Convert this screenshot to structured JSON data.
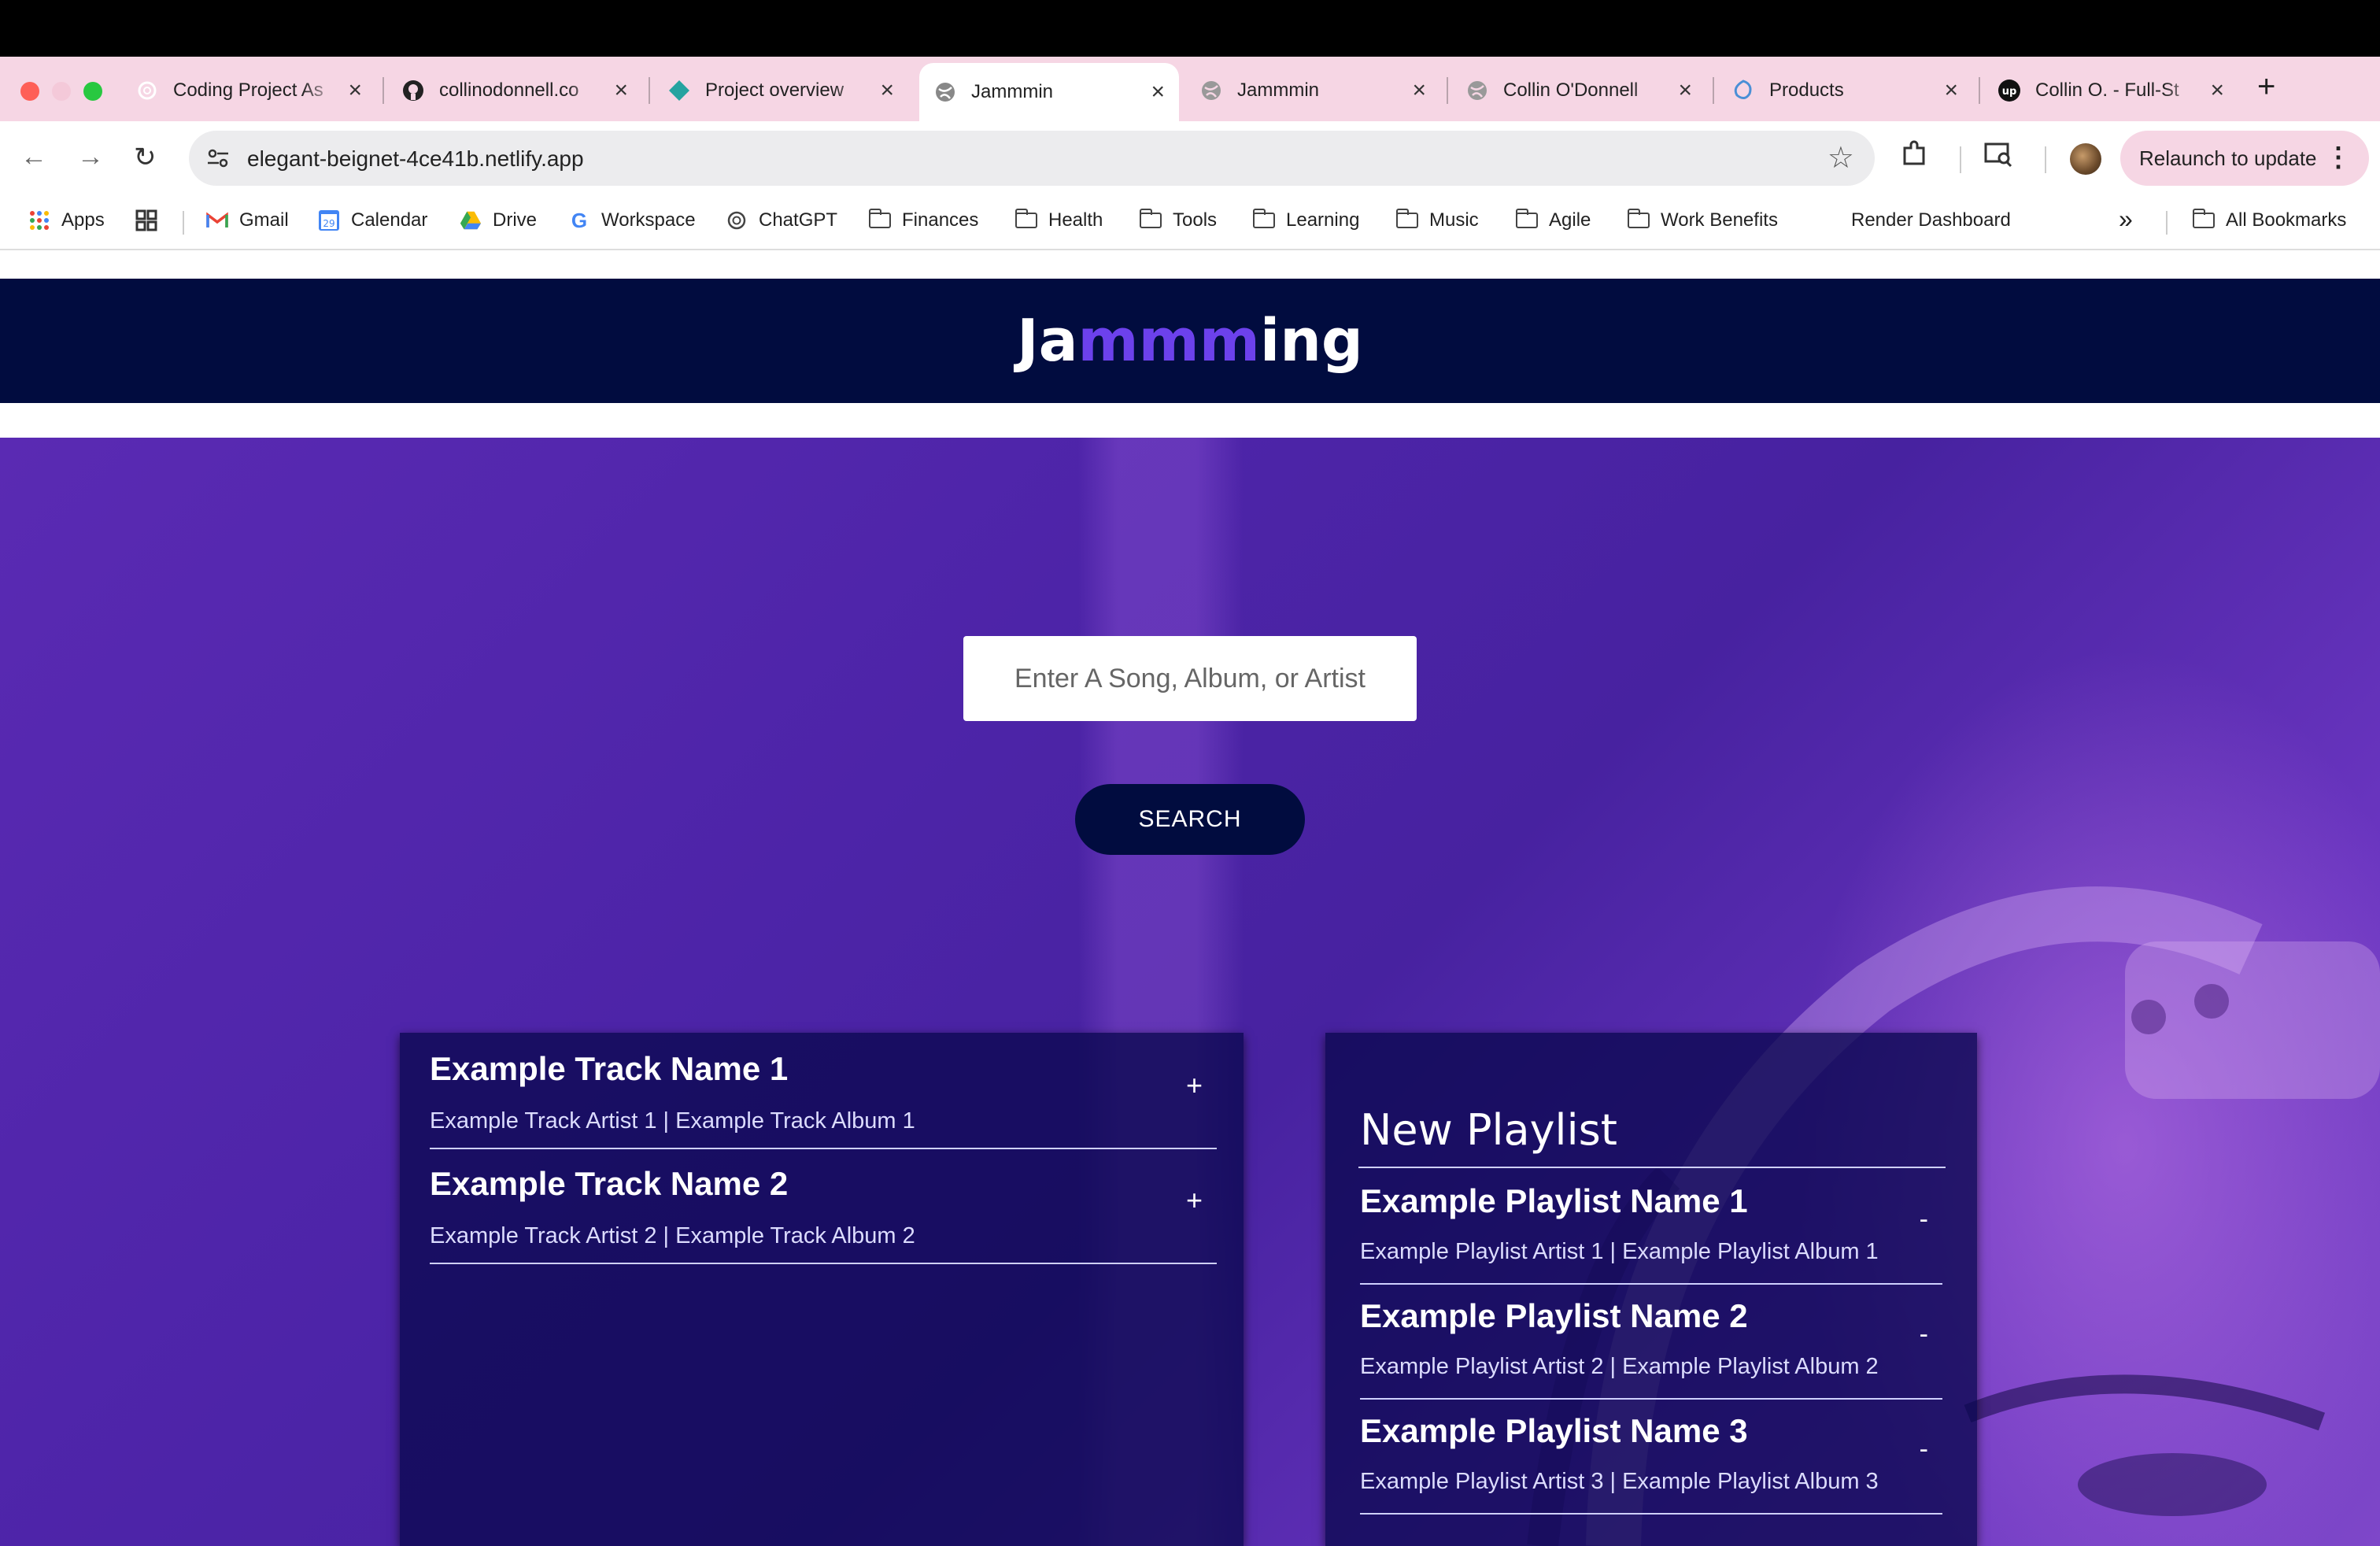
{
  "browser": {
    "tabs": [
      {
        "title": "Coding Project As",
        "icon": "openai-icon"
      },
      {
        "title": "collinodonnell.co",
        "icon": "github-icon"
      },
      {
        "title": "Project overview",
        "icon": "netlify-icon"
      },
      {
        "title": "Jammmin",
        "icon": "globe-icon",
        "active": true
      },
      {
        "title": "Jammmin",
        "icon": "globe-icon"
      },
      {
        "title": "Collin O'Donnell",
        "icon": "globe-icon"
      },
      {
        "title": "Products",
        "icon": "product-icon"
      },
      {
        "title": "Collin O. - Full-St",
        "icon": "upwork-icon"
      }
    ],
    "close_glyph": "×",
    "new_tab_glyph": "+",
    "url": "elegant-beignet-4ce41b.netlify.app",
    "relaunch_label": "Relaunch to update",
    "bookmarks": [
      {
        "label": "Apps",
        "icon": "apps-grid-icon"
      },
      {
        "label": "Gmail",
        "icon": "gmail-icon"
      },
      {
        "label": "Calendar",
        "icon": "calendar-icon"
      },
      {
        "label": "Drive",
        "icon": "drive-icon"
      },
      {
        "label": "Workspace",
        "icon": "google-icon"
      },
      {
        "label": "ChatGPT",
        "icon": "openai-icon"
      },
      {
        "label": "Finances",
        "icon": "folder-icon"
      },
      {
        "label": "Health",
        "icon": "folder-icon"
      },
      {
        "label": "Tools",
        "icon": "folder-icon"
      },
      {
        "label": "Learning",
        "icon": "folder-icon"
      },
      {
        "label": "Music",
        "icon": "folder-icon"
      },
      {
        "label": "Agile",
        "icon": "folder-icon"
      },
      {
        "label": "Work Benefits",
        "icon": "folder-icon"
      },
      {
        "label": "Render Dashboard",
        "icon": ""
      }
    ],
    "overflow_glyph": "»",
    "all_bookmarks_label": "All Bookmarks",
    "calendar_day": "29"
  },
  "app": {
    "logo": {
      "prefix": "Ja",
      "highlight": "mmm",
      "suffix": "ing"
    },
    "search_placeholder": "Enter A Song, Album, or Artist",
    "search_button": "SEARCH",
    "results": [
      {
        "name": "Example Track Name 1",
        "info": "Example Track Artist 1 | Example Track Album 1",
        "action": "+"
      },
      {
        "name": "Example Track Name 2",
        "info": "Example Track Artist 2 | Example Track Album 2",
        "action": "+"
      }
    ],
    "playlist": {
      "title": "New Playlist",
      "tracks": [
        {
          "name": "Example Playlist Name 1",
          "info": "Example Playlist Artist 1 | Example Playlist Album 1",
          "action": "-"
        },
        {
          "name": "Example Playlist Name 2",
          "info": "Example Playlist Artist 2 | Example Playlist Album 2",
          "action": "-"
        },
        {
          "name": "Example Playlist Name 3",
          "info": "Example Playlist Artist 3 | Example Playlist Album 3",
          "action": "-"
        }
      ]
    }
  },
  "colors": {
    "header": "#010c3f",
    "accent": "#6c41ec",
    "tabbar": "#f6d6e4"
  }
}
